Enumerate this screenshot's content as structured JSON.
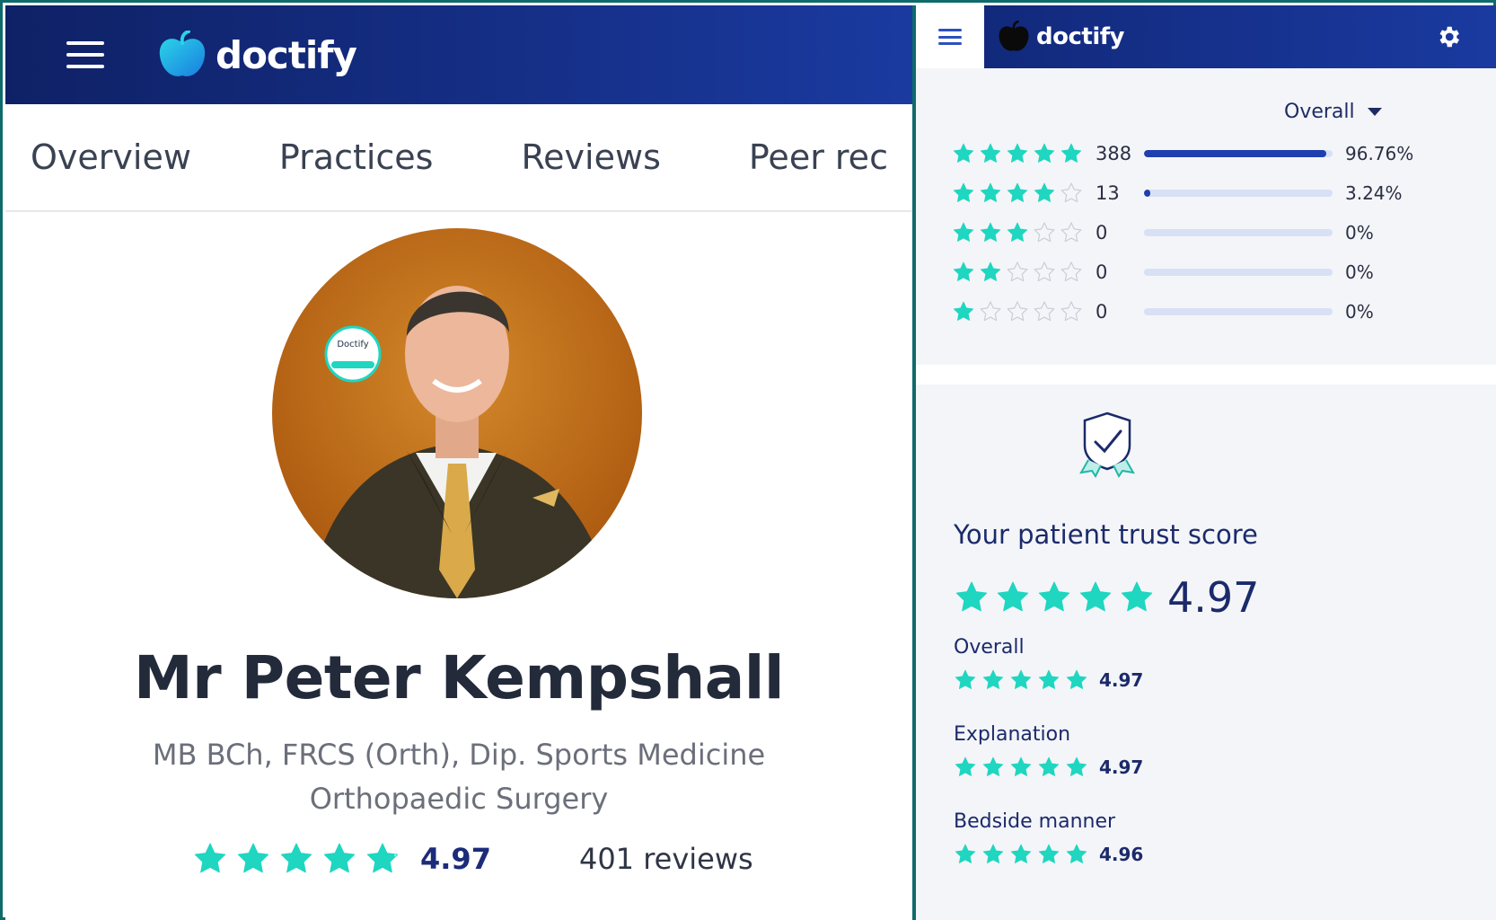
{
  "left": {
    "brand": "doctify",
    "tabs": [
      "Overview",
      "Practices",
      "Reviews",
      "Peer rec"
    ],
    "badge": {
      "text": "Doctify"
    },
    "profile": {
      "name": "Mr Peter Kempshall",
      "qualifications": "MB BCh, FRCS (Orth), Dip. Sports Medicine",
      "specialty": "Orthopaedic Surgery",
      "rating": "4.97",
      "stars": 4.9,
      "reviews": "401 reviews"
    }
  },
  "right": {
    "brand": "doctify",
    "dropdown": "Overall",
    "breakdown": [
      {
        "stars": 5,
        "count": "388",
        "percent": "96.76%",
        "fraction": 0.9676
      },
      {
        "stars": 4,
        "count": "13",
        "percent": "3.24%",
        "fraction": 0.0324
      },
      {
        "stars": 3,
        "count": "0",
        "percent": "0%",
        "fraction": 0
      },
      {
        "stars": 2,
        "count": "0",
        "percent": "0%",
        "fraction": 0
      },
      {
        "stars": 1,
        "count": "0",
        "percent": "0%",
        "fraction": 0
      }
    ],
    "trust": {
      "title": "Your patient trust score",
      "score": "4.97",
      "categories": [
        {
          "label": "Overall",
          "value": "4.97"
        },
        {
          "label": "Explanation",
          "value": "4.97"
        },
        {
          "label": "Bedside manner",
          "value": "4.96"
        }
      ]
    }
  },
  "colors": {
    "star": "#1fd6c0",
    "empty_star": "#c9ced8",
    "header": "#0f2166",
    "accent": "#1f3fb0"
  }
}
